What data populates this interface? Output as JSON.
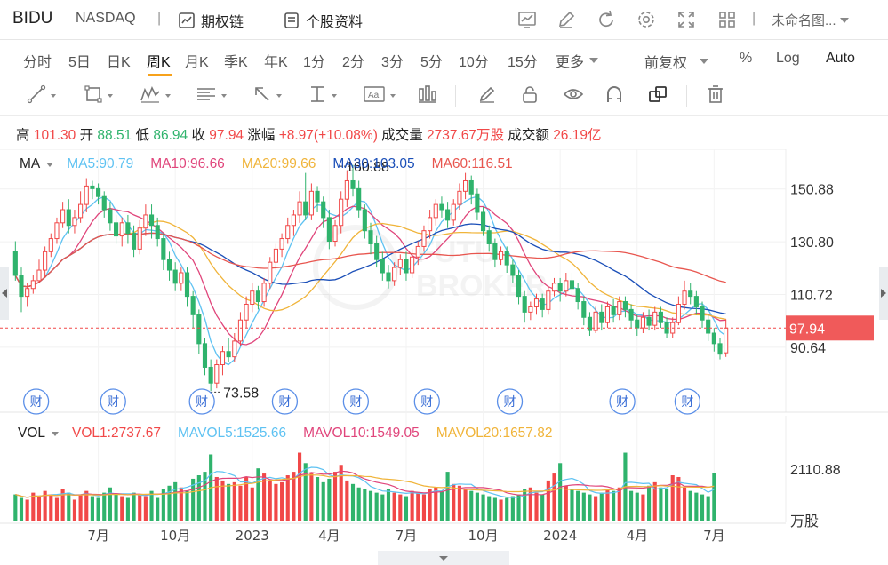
{
  "header": {
    "ticker": "BIDU",
    "exchange": "NASDAQ",
    "separator": "|",
    "options_chain": "期权链",
    "stock_profile": "个股资料",
    "layout_name": "未命名图..."
  },
  "periods": [
    "分时",
    "5日",
    "日K",
    "周K",
    "月K",
    "季K",
    "年K",
    "1分",
    "2分",
    "3分",
    "5分",
    "10分",
    "15分",
    "更多"
  ],
  "active_period": "周K",
  "right_options": {
    "adjust": "前复权",
    "percent": "%",
    "log": "Log",
    "auto": "Auto"
  },
  "ohlc": {
    "high_label": "高",
    "high": "101.30",
    "open_label": "开",
    "open": "88.51",
    "low_label": "低",
    "low": "86.94",
    "close_label": "收",
    "close": "97.94",
    "change_label": "涨幅",
    "change": "+8.97(+10.08%)",
    "volume_label": "成交量",
    "volume": "2737.67万股",
    "turnover_label": "成交额",
    "turnover": "26.19亿"
  },
  "ma_legend": {
    "name": "MA",
    "ma5": "MA5:90.79",
    "ma10": "MA10:96.66",
    "ma20": "MA20:99.66",
    "ma30": "MA30:103.05",
    "ma60": "MA60:116.51"
  },
  "vol_legend": {
    "name": "VOL",
    "vol1": "VOL1:2737.67",
    "mavol5": "MAVOL5:1525.66",
    "mavol10": "MAVOL10:1549.05",
    "mavol20": "MAVOL20:1657.82"
  },
  "colors": {
    "up": "#f14848",
    "down": "#2fb36c",
    "ma5": "#5ec2f2",
    "ma10": "#e0457b",
    "ma20": "#f0b43a",
    "ma30": "#1b4fb8",
    "ma60": "#e8564f",
    "accent": "#f7a21b"
  },
  "chart_data": {
    "type": "candlestick",
    "y_ticks": [
      "150.88",
      "130.80",
      "110.72",
      "90.64"
    ],
    "last_price_tag": "97.94",
    "high_marker": "160.88",
    "low_marker": "73.58",
    "x_ticks": [
      "7月",
      "10月",
      "2023",
      "4月",
      "7月",
      "10月",
      "2024",
      "4月",
      "7月"
    ],
    "vol_tick": "2110.88",
    "vol_unit": "万股",
    "event_badge": "财",
    "event_count": 9,
    "ylim": [
      72,
      166
    ],
    "candles": [
      [
        127,
        118,
        131,
        116
      ],
      [
        118,
        110,
        121,
        104
      ],
      [
        110,
        113,
        115,
        106
      ],
      [
        113,
        116,
        118,
        111
      ],
      [
        116,
        120,
        124,
        115
      ],
      [
        120,
        127,
        129,
        117
      ],
      [
        127,
        132,
        134,
        125
      ],
      [
        132,
        138,
        140,
        130
      ],
      [
        138,
        143,
        146,
        136
      ],
      [
        143,
        137,
        147,
        134
      ],
      [
        137,
        140,
        143,
        134
      ],
      [
        140,
        145,
        150,
        138
      ],
      [
        145,
        152,
        155,
        142
      ],
      [
        152,
        151,
        154,
        147
      ],
      [
        151,
        148,
        153,
        145
      ],
      [
        148,
        143,
        150,
        140
      ],
      [
        143,
        138,
        146,
        135
      ],
      [
        138,
        133,
        141,
        130
      ],
      [
        133,
        138,
        140,
        129
      ],
      [
        138,
        134,
        141,
        130
      ],
      [
        134,
        128,
        137,
        125
      ],
      [
        128,
        136,
        139,
        126
      ],
      [
        136,
        141,
        145,
        133
      ],
      [
        141,
        137,
        145,
        132
      ],
      [
        137,
        132,
        140,
        129
      ],
      [
        132,
        124,
        134,
        120
      ],
      [
        124,
        120,
        127,
        116
      ],
      [
        120,
        115,
        123,
        112
      ],
      [
        115,
        119,
        121,
        112
      ],
      [
        119,
        110,
        121,
        106
      ],
      [
        110,
        103,
        112,
        98
      ],
      [
        103,
        92,
        105,
        88
      ],
      [
        92,
        83,
        94,
        80
      ],
      [
        83,
        77,
        86,
        74
      ],
      [
        77,
        84,
        86,
        75
      ],
      [
        84,
        89,
        91,
        80
      ],
      [
        89,
        87,
        94,
        85
      ],
      [
        87,
        93,
        96,
        85
      ],
      [
        93,
        101,
        104,
        91
      ],
      [
        101,
        107,
        110,
        98
      ],
      [
        107,
        112,
        115,
        104
      ],
      [
        112,
        108,
        114,
        105
      ],
      [
        108,
        115,
        117,
        106
      ],
      [
        115,
        123,
        125,
        113
      ],
      [
        123,
        128,
        130,
        120
      ],
      [
        128,
        132,
        134,
        125
      ],
      [
        132,
        137,
        140,
        130
      ],
      [
        137,
        141,
        143,
        133
      ],
      [
        141,
        146,
        150,
        138
      ],
      [
        146,
        141,
        157,
        139
      ],
      [
        141,
        150,
        153,
        139
      ],
      [
        150,
        146,
        152,
        142
      ],
      [
        146,
        140,
        148,
        136
      ],
      [
        140,
        131,
        143,
        128
      ],
      [
        131,
        137,
        139,
        129
      ],
      [
        137,
        147,
        150,
        134
      ],
      [
        147,
        154,
        158,
        144
      ],
      [
        154,
        151,
        160,
        148
      ],
      [
        151,
        143,
        154,
        140
      ],
      [
        143,
        135,
        145,
        132
      ],
      [
        135,
        130,
        138,
        126
      ],
      [
        130,
        124,
        133,
        121
      ],
      [
        124,
        119,
        127,
        116
      ],
      [
        119,
        116,
        122,
        113
      ],
      [
        116,
        121,
        123,
        114
      ],
      [
        121,
        124,
        126,
        118
      ],
      [
        124,
        119,
        127,
        116
      ],
      [
        119,
        125,
        128,
        117
      ],
      [
        125,
        129,
        131,
        122
      ],
      [
        129,
        135,
        137,
        127
      ],
      [
        135,
        140,
        143,
        132
      ],
      [
        140,
        145,
        147,
        137
      ],
      [
        145,
        143,
        148,
        140
      ],
      [
        143,
        139,
        146,
        136
      ],
      [
        139,
        145,
        147,
        137
      ],
      [
        145,
        150,
        153,
        143
      ],
      [
        150,
        154,
        157,
        147
      ],
      [
        154,
        149,
        156,
        145
      ],
      [
        149,
        142,
        151,
        139
      ],
      [
        142,
        135,
        144,
        133
      ],
      [
        135,
        130,
        137,
        127
      ],
      [
        130,
        124,
        132,
        121
      ],
      [
        124,
        127,
        129,
        122
      ],
      [
        127,
        122,
        129,
        119
      ],
      [
        122,
        118,
        124,
        115
      ],
      [
        118,
        110,
        120,
        107
      ],
      [
        110,
        104,
        112,
        100
      ],
      [
        104,
        106,
        108,
        101
      ],
      [
        106,
        109,
        111,
        103
      ],
      [
        109,
        105,
        111,
        102
      ],
      [
        105,
        112,
        114,
        103
      ],
      [
        112,
        115,
        117,
        110
      ],
      [
        115,
        112,
        117,
        108
      ],
      [
        112,
        116,
        119,
        110
      ],
      [
        116,
        113,
        119,
        110
      ],
      [
        113,
        108,
        115,
        105
      ],
      [
        108,
        102,
        110,
        99
      ],
      [
        102,
        97,
        104,
        95
      ],
      [
        97,
        104,
        106,
        96
      ],
      [
        104,
        100,
        107,
        97
      ],
      [
        100,
        106,
        108,
        98
      ],
      [
        106,
        103,
        109,
        100
      ],
      [
        103,
        108,
        110,
        101
      ],
      [
        108,
        105,
        110,
        102
      ],
      [
        105,
        101,
        107,
        98
      ],
      [
        101,
        98,
        103,
        95
      ],
      [
        98,
        102,
        104,
        96
      ],
      [
        102,
        99,
        105,
        97
      ],
      [
        99,
        104,
        106,
        97
      ],
      [
        104,
        100,
        106,
        98
      ],
      [
        100,
        96,
        102,
        94
      ],
      [
        96,
        100,
        102,
        94
      ],
      [
        100,
        107,
        110,
        99
      ],
      [
        107,
        112,
        116,
        105
      ],
      [
        112,
        110,
        115,
        107
      ],
      [
        110,
        106,
        112,
        103
      ],
      [
        106,
        101,
        108,
        98
      ],
      [
        101,
        96,
        103,
        93
      ],
      [
        96,
        92,
        98,
        89
      ],
      [
        92,
        88,
        94,
        86
      ],
      [
        88.51,
        97.94,
        101.3,
        86.94
      ]
    ],
    "volumes": [
      1500,
      1300,
      1200,
      1600,
      1400,
      1700,
      1500,
      1300,
      1800,
      1600,
      1200,
      1500,
      1700,
      1400,
      1300,
      1600,
      1900,
      1500,
      1400,
      1300,
      1600,
      1500,
      1400,
      1700,
      1300,
      1800,
      2000,
      2200,
      1900,
      1700,
      2400,
      2600,
      2800,
      3800,
      2500,
      2300,
      2100,
      2200,
      2000,
      2500,
      1900,
      3000,
      2700,
      2300,
      2100,
      2200,
      2600,
      2800,
      3900,
      3300,
      2700,
      2500,
      2200,
      2400,
      2800,
      3200,
      2300,
      2100,
      1900,
      1800,
      1700,
      1600,
      1500,
      1800,
      1600,
      1500,
      1400,
      1700,
      1600,
      1500,
      1800,
      1900,
      1700,
      2800,
      2100,
      2000,
      1800,
      1700,
      1600,
      1500,
      1400,
      1300,
      1200,
      1300,
      1400,
      1500,
      1800,
      1900,
      1600,
      1500,
      2300,
      2700,
      3300,
      2000,
      1800,
      1700,
      1600,
      1500,
      1400,
      1600,
      1800,
      1700,
      1900,
      3900,
      1700,
      1600,
      1500,
      2000,
      2200,
      1900,
      1800,
      2600,
      2500,
      1900,
      1700,
      1600,
      1500,
      1400,
      2737.67
    ]
  }
}
